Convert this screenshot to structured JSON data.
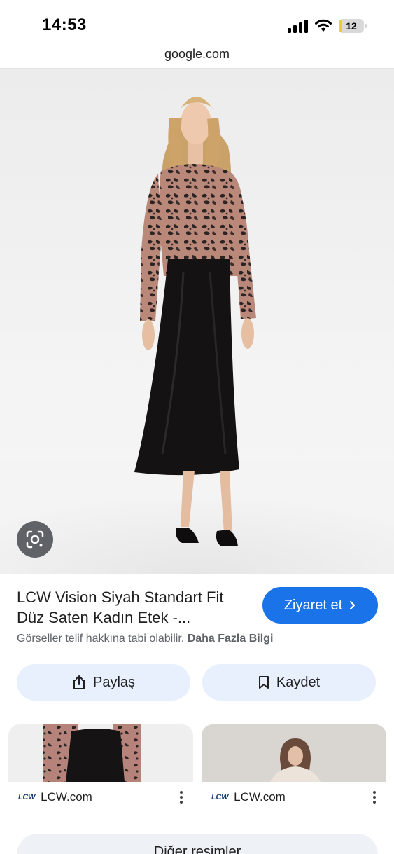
{
  "status_bar": {
    "time": "14:53",
    "battery": "12",
    "battery_level_percent": 12,
    "battery_color": "#f5cc30",
    "icons": [
      "signal-icon",
      "wifi-icon",
      "battery-icon"
    ]
  },
  "browser": {
    "url": "google.com"
  },
  "result": {
    "title": "LCW Vision Siyah Standart Fit Düz Saten Kadın Etek -...",
    "visit_label": "Ziyaret et",
    "copyright_text": "Görseller telif hakkına tabi olabilir.",
    "more_info_link": "Daha Fazla Bilgi",
    "accent_color": "#1a73e8"
  },
  "actions": {
    "share_label": "Paylaş",
    "save_label": "Kaydet"
  },
  "related": [
    {
      "source_logo": "LCW",
      "source": "LCW.com"
    },
    {
      "source_logo": "LCW",
      "source": "LCW.com"
    }
  ],
  "more_images_label": "Diğer resimler"
}
